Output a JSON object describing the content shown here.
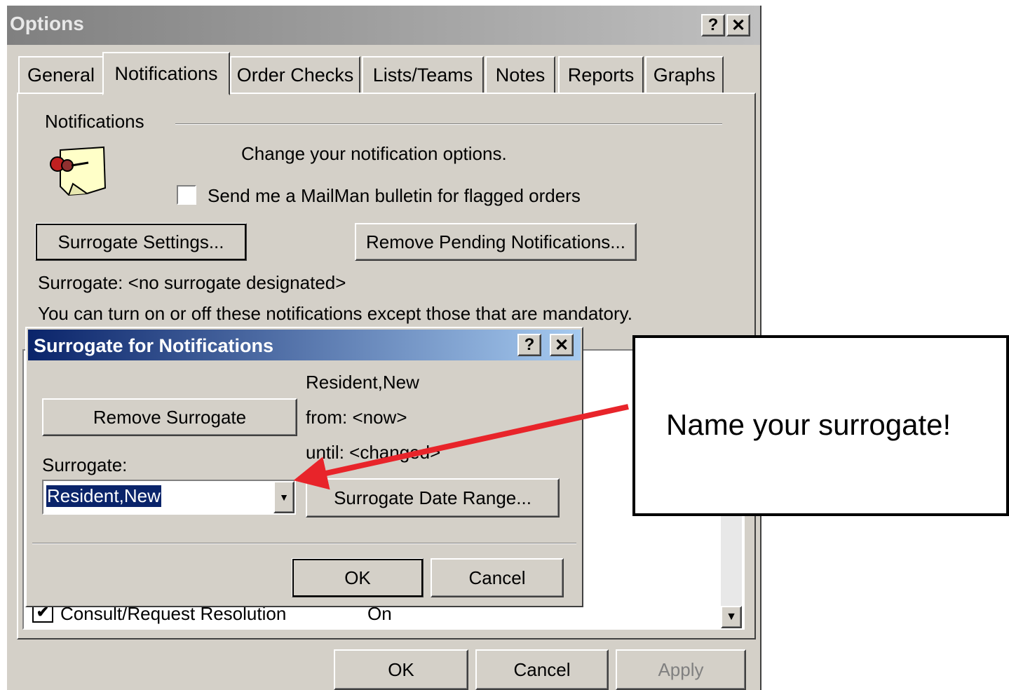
{
  "options_window": {
    "title": "Options",
    "help_glyph": "?",
    "close_glyph": "✕",
    "tabs": [
      {
        "label": "General"
      },
      {
        "label": "Notifications"
      },
      {
        "label": "Order Checks"
      },
      {
        "label": "Lists/Teams"
      },
      {
        "label": "Notes"
      },
      {
        "label": "Reports"
      },
      {
        "label": "Graphs"
      }
    ],
    "section_title": "Notifications",
    "icon": "pushpin-note-icon",
    "description": "Change your notification options.",
    "bulletin_checkbox_label": "Send me a MailMan bulletin for flagged orders",
    "bulletin_checked": false,
    "surrogate_settings_button": "Surrogate Settings...",
    "remove_pending_button": "Remove Pending Notifications...",
    "surrogate_status": "Surrogate: <no surrogate designated>",
    "info_text": "You can turn on or off these notifications except those that are mandatory.",
    "list_row": {
      "label": "Consult/Request Resolution",
      "value": "On",
      "checked": true
    },
    "ok_button": "OK",
    "cancel_button": "Cancel",
    "apply_button": "Apply"
  },
  "surrogate_dialog": {
    "title": "Surrogate for Notifications",
    "help_glyph": "?",
    "close_glyph": "✕",
    "name_text": "Resident,New",
    "from_text": "from: <now>",
    "until_text": "until: <changed>",
    "remove_button": "Remove Surrogate",
    "surrogate_label": "Surrogate:",
    "surrogate_value": "Resident,New",
    "date_range_button": "Surrogate Date Range...",
    "ok_button": "OK",
    "cancel_button": "Cancel"
  },
  "callout": {
    "text": "Name your surrogate!",
    "arrow_color": "#e8242a"
  }
}
